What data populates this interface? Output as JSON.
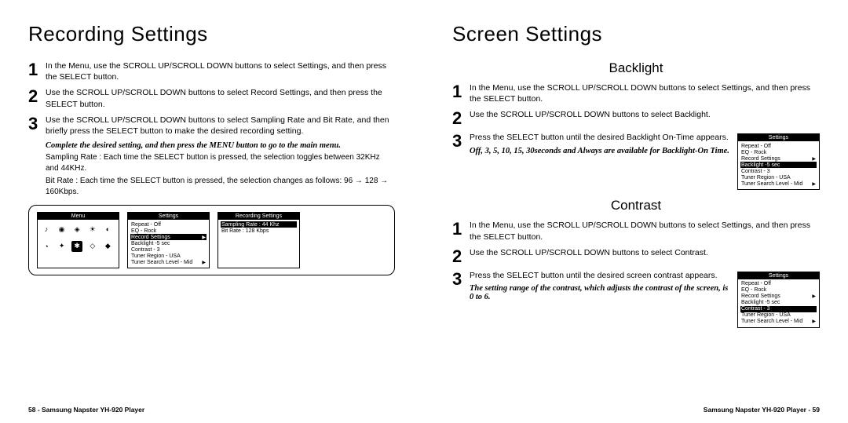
{
  "left": {
    "title": "Recording Settings",
    "steps": [
      "In the Menu, use the SCROLL UP/SCROLL DOWN buttons to select Settings, and then press the SELECT button.",
      "Use the SCROLL UP/SCROLL DOWN buttons to select Record Settings, and then press the SELECT button.",
      "Use the SCROLL UP/SCROLL DOWN buttons to select Sampling Rate and Bit Rate, and then briefly press the SELECT button to make the desired recording setting."
    ],
    "note_ital": "Complete the desired setting, and then press the MENU button to go to the main menu.",
    "sub1": "Sampling Rate : Each time the SELECT button is pressed, the selection toggles between 32KHz and 44KHz.",
    "sub2": "Bit Rate : Each time the SELECT button is pressed, the selection changes as follows: 96 → 128 → 160Kbps.",
    "screens": {
      "menu_hdr": "Menu",
      "settings_hdr": "Settings",
      "rec_hdr": "Recording Settings",
      "settings_lines": [
        {
          "t": "Repeat - Off"
        },
        {
          "t": "EQ - Rock"
        },
        {
          "t": "Record Settings",
          "sel": true,
          "arr": true
        },
        {
          "t": "Backlight -5 sec"
        },
        {
          "t": "Contrast - 3"
        },
        {
          "t": "Tuner Region - USA"
        },
        {
          "t": "Tuner Search Level - Mid",
          "arr": true
        }
      ],
      "rec_lines": [
        {
          "t": "Sampling Rate : 44 Khz",
          "sel": true
        },
        {
          "t": "Bit Rate : 128 Kbps"
        }
      ]
    },
    "footer": "58 - Samsung Napster YH-920 Player"
  },
  "right": {
    "title": "Screen Settings",
    "backlight": {
      "subtitle": "Backlight",
      "steps": [
        "In the Menu, use the SCROLL UP/SCROLL DOWN buttons to select Settings, and then press the SELECT button.",
        "Use the SCROLL UP/SCROLL DOWN buttons to select Backlight."
      ],
      "step3": "Press the SELECT button until the desired Backlight On-Time appears.",
      "note_ital": "Off, 3, 5, 10, 15, 30seconds and Always are available for Backlight-On Time.",
      "screen_hdr": "Settings",
      "screen_lines": [
        {
          "t": "Repeat - Off"
        },
        {
          "t": "EQ - Rock"
        },
        {
          "t": "Record Settings",
          "arr": true
        },
        {
          "t": "Backlight -5 sec",
          "sel": true
        },
        {
          "t": "Contrast - 3"
        },
        {
          "t": "Tuner Region - USA"
        },
        {
          "t": "Tuner Search Level - Mid",
          "arr": true
        }
      ]
    },
    "contrast": {
      "subtitle": "Contrast",
      "steps": [
        "In the Menu, use the SCROLL UP/SCROLL DOWN buttons to select Settings, and then press the SELECT button.",
        "Use the SCROLL UP/SCROLL DOWN buttons to select Contrast."
      ],
      "step3": "Press the SELECT button until the desired screen contrast appears.",
      "note_ital": "The setting range of the contrast, which adjusts the contrast of the screen, is 0 to 6.",
      "screen_hdr": "Settings",
      "screen_lines": [
        {
          "t": "Repeat - Off"
        },
        {
          "t": "EQ - Rock"
        },
        {
          "t": "Record Settings",
          "arr": true
        },
        {
          "t": "Backlight -5 sec"
        },
        {
          "t": "Contrast - 3",
          "sel": true
        },
        {
          "t": "Tuner Region - USA"
        },
        {
          "t": "Tuner Search Level - Mid",
          "arr": true
        }
      ]
    },
    "footer": "Samsung Napster YH-920 Player - 59"
  }
}
